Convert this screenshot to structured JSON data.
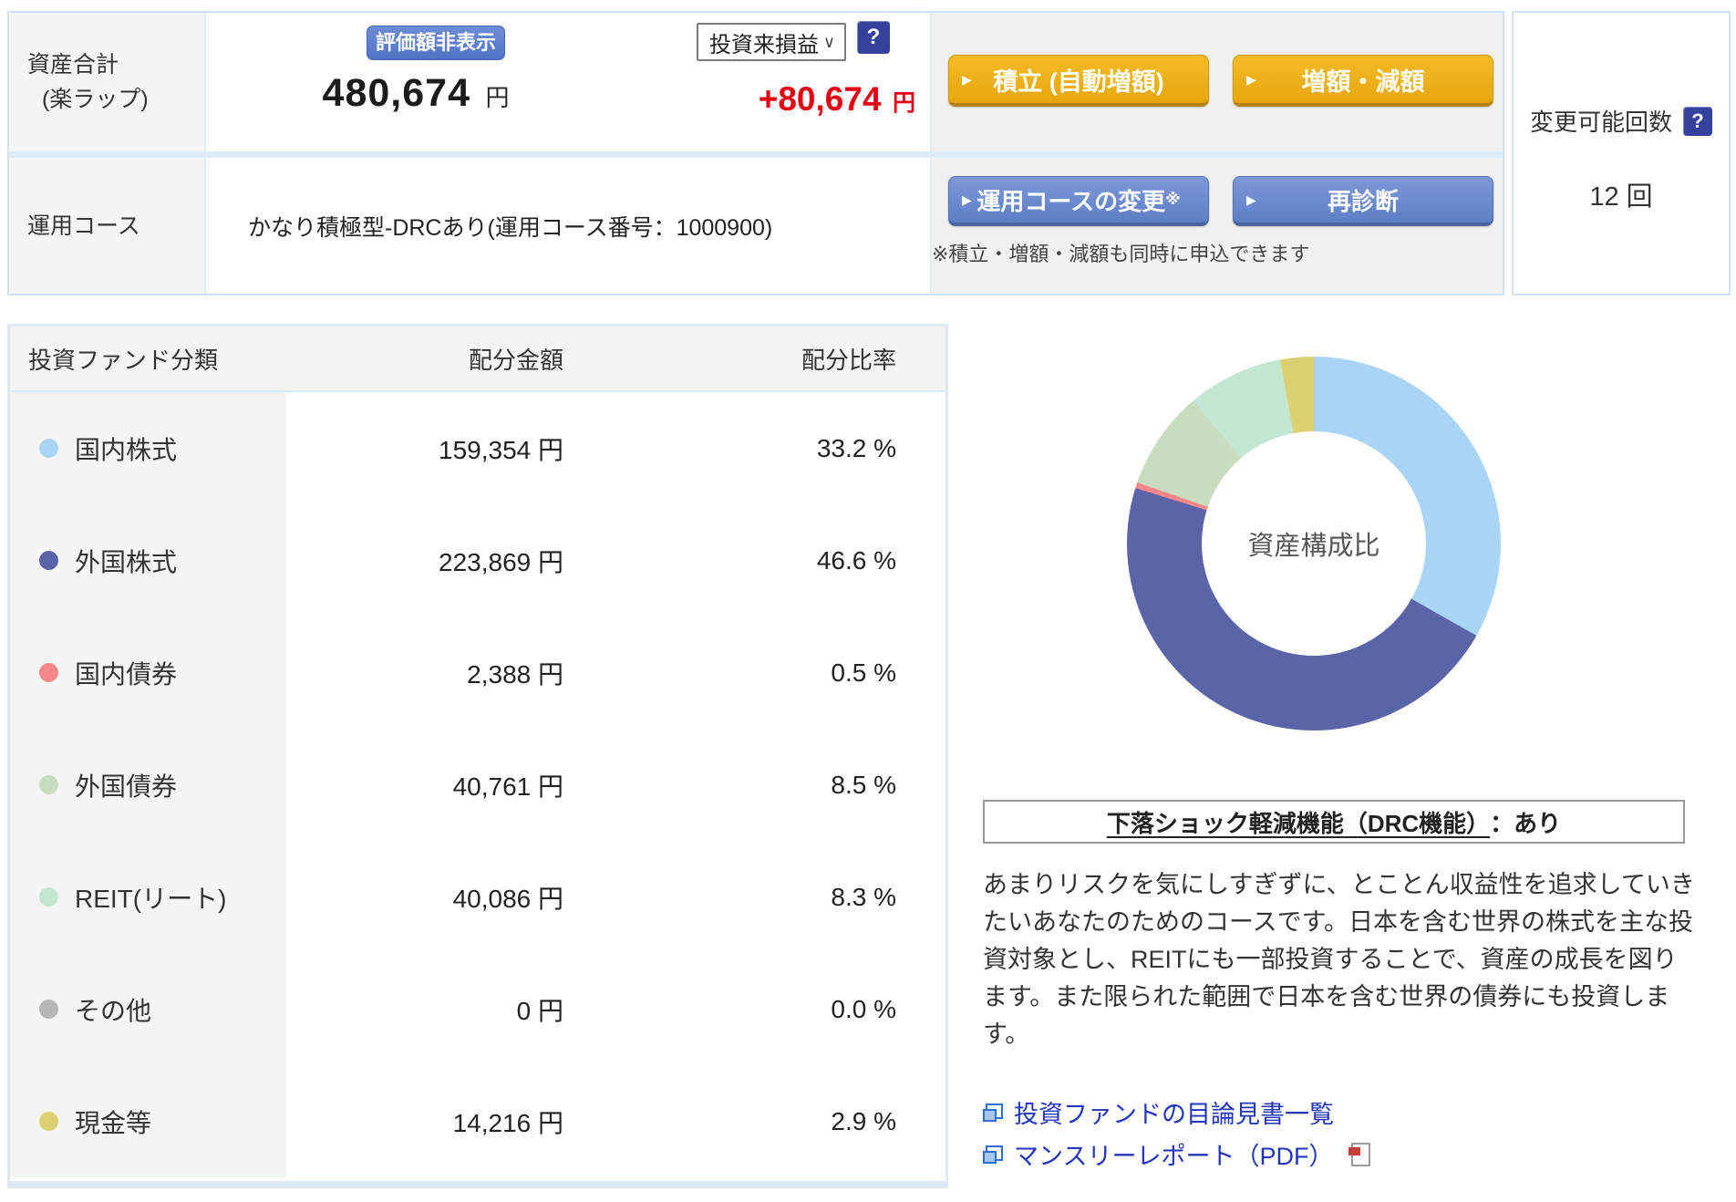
{
  "glyphs": {
    "arrow": "▶",
    "chevron": "∨",
    "help": "?"
  },
  "colors": {
    "panel_border_blue": "#cfe1ef",
    "cell_gray": "#f4f4f3",
    "buttons_area_gray": "#f0f0ee",
    "gold_button": "#eaa915",
    "blue_button": "#6384cb",
    "hide_button_blue": "#5b7ecc",
    "profit_red": "#e60012",
    "link_blue": "#2235bb",
    "help_icon_navy": "#35429b"
  },
  "header": {
    "asset_label_line1": "資産合計",
    "asset_label_line2": "(楽ラップ)",
    "hide_value_button": "評価額非表示",
    "total_amount": "480,674",
    "total_unit": "円",
    "profit_select_value": "投資来損益",
    "profit_amount": "+80,674",
    "profit_unit": "円",
    "accumulate_button": "積立 (自動増額)",
    "increase_decrease_button": "増額・減額",
    "course_label": "運用コース",
    "course_value": "かなり積極型-DRCあり(運用コース番号：1000900)",
    "course_change_button": "運用コースの変更",
    "course_change_mark": "※",
    "rediagnose_button": "再診断",
    "apply_note": "※積立・増額・減額も同時に申込できます"
  },
  "change_panel": {
    "label": "変更可能回数",
    "value": "12 回"
  },
  "allocation_table": {
    "col_category": "投資ファンド分類",
    "col_amount": "配分金額",
    "col_ratio": "配分比率",
    "rows": [
      {
        "label": "国内株式",
        "amount": "159,354 円",
        "ratio": "33.2 %"
      },
      {
        "label": "外国株式",
        "amount": "223,869 円",
        "ratio": "46.6 %"
      },
      {
        "label": "国内債券",
        "amount": "2,388 円",
        "ratio": "0.5 %"
      },
      {
        "label": "外国債券",
        "amount": "40,761 円",
        "ratio": "8.5 %"
      },
      {
        "label": "REIT(リート)",
        "amount": "40,086 円",
        "ratio": "8.3 %"
      },
      {
        "label": "その他",
        "amount": "0 円",
        "ratio": "0.0 %"
      },
      {
        "label": "現金等",
        "amount": "14,216 円",
        "ratio": "2.9 %"
      }
    ]
  },
  "chart_data": {
    "type": "pie",
    "subtype": "donut",
    "center_label": "資産構成比",
    "categories": [
      "国内株式",
      "外国株式",
      "国内債券",
      "外国債券",
      "REIT(リート)",
      "その他",
      "現金等"
    ],
    "values": [
      33.2,
      46.6,
      0.5,
      8.5,
      8.3,
      0.0,
      2.9
    ],
    "amounts_yen": [
      159354,
      223869,
      2388,
      40761,
      40086,
      0,
      14216
    ],
    "colors": [
      "#a9d4f6",
      "#5a64a6",
      "#f6888c",
      "#cadcc0",
      "#c3e6d2",
      "#b5b5b5",
      "#dcd172"
    ],
    "start_angle_deg": 0,
    "direction": "clockwise",
    "legend_position": "none"
  },
  "drc_box": {
    "title_underlined": "下落ショック軽減機能（DRC機能）",
    "title_suffix": "：あり"
  },
  "description": "あまりリスクを気にしすぎずに、とことん収益性を追求していきたいあなたのためのコースです。日本を含む世界の株式を主な投資対象とし、REITにも一部投資することで、資産の成長を図ります。また限られた範囲で日本を含む世界の債券にも投資します。",
  "links": {
    "prospectus": "投資ファンドの目論見書一覧",
    "monthly_report": "マンスリーレポート（PDF）"
  }
}
